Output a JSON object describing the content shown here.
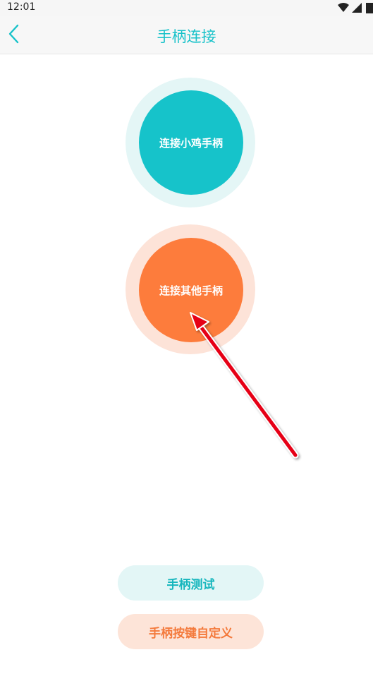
{
  "status_bar": {
    "time": "12:01",
    "icons": [
      "wifi-icon",
      "signal-icon",
      "battery-icon"
    ]
  },
  "header": {
    "back_icon": "chevron-left-icon",
    "title": "手柄连接"
  },
  "main": {
    "connect_xiaoji_label": "连接小鸡手柄",
    "connect_other_label": "连接其他手柄"
  },
  "footer": {
    "test_label": "手柄测试",
    "custom_keys_label": "手柄按键自定义"
  },
  "colors": {
    "accent_teal": "#16c3ca",
    "accent_orange": "#fd7c3c",
    "annotation_red": "#e60012"
  }
}
